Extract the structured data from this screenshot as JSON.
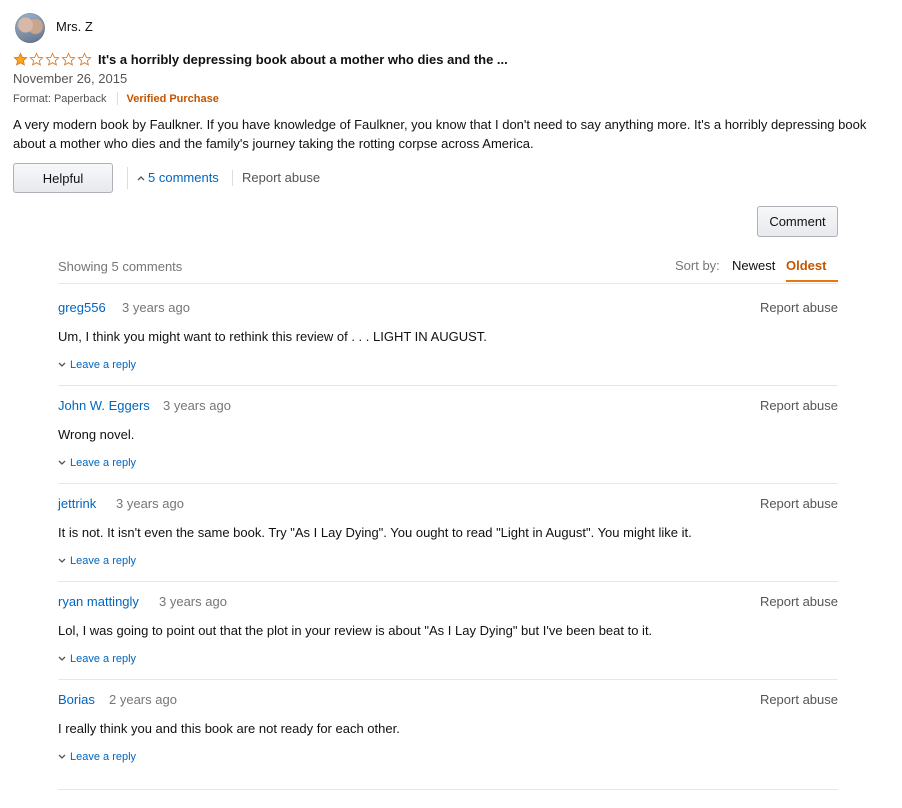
{
  "review": {
    "reviewer_name": "Mrs. Z",
    "rating": 1,
    "rating_max": 5,
    "title": "It's a horribly depressing book about a mother who dies and the ...",
    "date": "November 26, 2015",
    "format": "Format: Paperback",
    "verified": "Verified Purchase",
    "body": "A very modern book by Faulkner. If you have knowledge of Faulkner, you know that I don't need to say anything more. It's a horribly depressing book about a mother who dies and the family's journey taking the rotting corpse across America."
  },
  "actions": {
    "helpful_label": "Helpful",
    "comments_toggle_label": "5 comments",
    "report_abuse_label": "Report abuse",
    "comment_button_label": "Comment"
  },
  "comments_header": {
    "showing": "Showing 5 comments",
    "sort_label": "Sort by:",
    "sort_newest": "Newest",
    "sort_oldest": "Oldest",
    "active_sort": "Oldest"
  },
  "comments": [
    {
      "author": "greg556",
      "time": "3 years ago",
      "report": "Report abuse",
      "text": "Um, I think you might want to rethink this review of . . . LIGHT IN AUGUST.",
      "reply": "Leave a reply"
    },
    {
      "author": "John W. Eggers",
      "time": "3 years ago",
      "report": "Report abuse",
      "text": "Wrong novel.",
      "reply": "Leave a reply"
    },
    {
      "author": "jettrink",
      "time": "3 years ago",
      "report": "Report abuse",
      "text": "It is not. It isn't even the same book. Try \"As I Lay Dying\". You ought to read \"Light in August\". You might like it.",
      "reply": "Leave a reply"
    },
    {
      "author": "ryan mattingly",
      "time": "3 years ago",
      "report": "Report abuse",
      "text": "Lol, I was going to point out that the plot in your review is about \"As I Lay Dying\" but I've been beat to it.",
      "reply": "Leave a reply"
    },
    {
      "author": "Borias",
      "time": "2 years ago",
      "report": "Report abuse",
      "text": "I really think you and this book are not ready for each other.",
      "reply": "Leave a reply"
    }
  ],
  "colors": {
    "star_filled": "#ffa41c",
    "star_outline": "#de7921",
    "link": "#0066c0",
    "verified": "#c45500",
    "sort_active": "#c45500"
  }
}
